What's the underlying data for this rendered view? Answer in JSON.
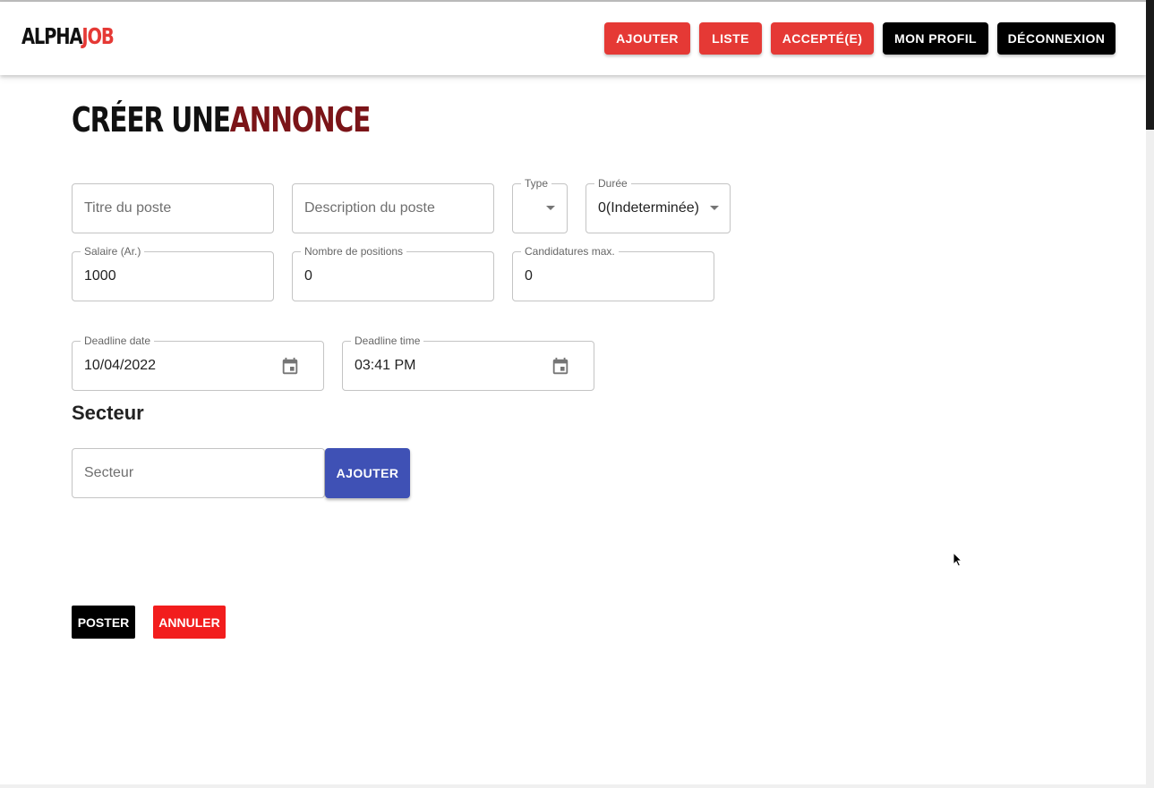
{
  "header": {
    "logo_part1": "ALPHA",
    "logo_part2": "JOB",
    "nav": {
      "add": "AJOUTER",
      "list": "LISTE",
      "accepted": "ACCEPTÉ(E)",
      "profile": "MON PROFIL",
      "logout": "DÉCONNEXION"
    }
  },
  "page": {
    "title_part1": "CRÉER UNE",
    "title_part2": "ANNONCE"
  },
  "form": {
    "job_title": {
      "placeholder": "Titre du poste"
    },
    "job_description": {
      "placeholder": "Description du poste"
    },
    "type": {
      "label": "Type",
      "value": ""
    },
    "duration": {
      "label": "Durée",
      "value": "0(Indeterminée)"
    },
    "salary": {
      "label": "Salaire (Ar.)",
      "value": "1000"
    },
    "positions": {
      "label": "Nombre de positions",
      "value": "0"
    },
    "max_applications": {
      "label": "Candidatures max.",
      "value": "0"
    },
    "deadline_date": {
      "label": "Deadline date",
      "value": "10/04/2022"
    },
    "deadline_time": {
      "label": "Deadline time",
      "value": "03:41 PM"
    }
  },
  "sector": {
    "title": "Secteur",
    "placeholder": "Secteur",
    "add_button": "AJOUTER"
  },
  "actions": {
    "post": "POSTER",
    "cancel": "ANNULER"
  },
  "colors": {
    "accent_red": "#e53935",
    "title_dark_red": "#7b1418",
    "indigo": "#3f51b5",
    "cancel_red": "#f21d1d"
  }
}
